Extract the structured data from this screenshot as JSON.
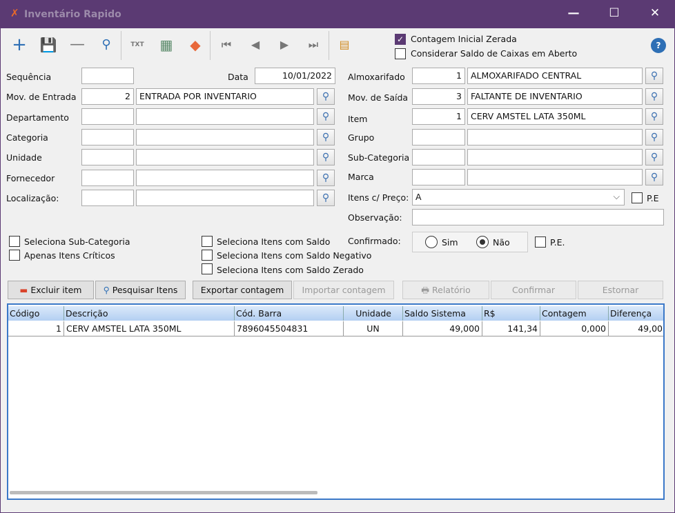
{
  "window": {
    "title": "Inventário Rapido",
    "minimize": "—",
    "maximize": "☐",
    "close": "✕"
  },
  "toolbar": {
    "icons": [
      "plus-icon",
      "save-icon",
      "minus-icon",
      "search-icon",
      "txt-export-icon",
      "grid-icon",
      "eraser-icon",
      "first-icon",
      "prev-icon",
      "next-icon",
      "last-icon",
      "log-icon"
    ],
    "contagem_inicial_zerada": {
      "label": "Contagem Inicial Zerada",
      "checked": true
    },
    "considerar_saldo": {
      "label": "Considerar Saldo de Caixas em Aberto",
      "checked": false
    },
    "help": "?"
  },
  "form": {
    "sequencia": {
      "label": "Sequência",
      "value": ""
    },
    "data": {
      "label": "Data",
      "value": "10/01/2022"
    },
    "mov_entrada": {
      "label": "Mov. de Entrada",
      "code": "2",
      "desc": "ENTRADA POR INVENTARIO"
    },
    "departamento": {
      "label": "Departamento",
      "code": "",
      "desc": ""
    },
    "categoria": {
      "label": "Categoria",
      "code": "",
      "desc": ""
    },
    "unidade": {
      "label": "Unidade",
      "code": "",
      "desc": ""
    },
    "fornecedor": {
      "label": "Fornecedor",
      "code": "",
      "desc": ""
    },
    "localizacao": {
      "label": "Localização:",
      "code": "",
      "desc": ""
    },
    "almoxarifado": {
      "label": "Almoxarifado",
      "code": "1",
      "desc": "ALMOXARIFADO CENTRAL"
    },
    "mov_saida": {
      "label": "Mov. de Saída",
      "code": "3",
      "desc": "FALTANTE DE INVENTARIO"
    },
    "item": {
      "label": "Item",
      "code": "1",
      "desc": "CERV AMSTEL LATA 350ML"
    },
    "grupo": {
      "label": "Grupo",
      "code": "",
      "desc": ""
    },
    "subcategoria": {
      "label": "Sub-Categoria",
      "code": "",
      "desc": ""
    },
    "marca": {
      "label": "Marca",
      "code": "",
      "desc": ""
    },
    "itens_preco": {
      "label": "Itens c/ Preço:",
      "value": "A",
      "pe_label": "P.E",
      "pe_checked": false
    },
    "observacao": {
      "label": "Observação:",
      "value": ""
    }
  },
  "options": {
    "seleciona_subcategoria": "Seleciona Sub-Categoria",
    "apenas_criticos": "Apenas Itens Críticos",
    "itens_saldo": "Seleciona Itens com Saldo",
    "itens_saldo_negativo": "Seleciona Itens com Saldo Negativo",
    "itens_saldo_zerado": "Seleciona Itens com Saldo Zerado",
    "confirmado": {
      "label": "Confirmado:",
      "sim": "Sim",
      "nao": "Não",
      "selected": "Não",
      "pe_label": "P.E."
    }
  },
  "buttons": {
    "excluir": "Excluir item",
    "pesquisar": "Pesquisar Itens",
    "exportar": "Exportar contagem",
    "importar": "Importar contagem",
    "relatorio": "Relatório",
    "confirmar": "Confirmar",
    "estornar": "Estornar"
  },
  "grid": {
    "columns": [
      "Código",
      "Descrição",
      "Cód. Barra",
      "Unidade",
      "Saldo Sistema",
      "R$",
      "Contagem",
      "Diferença"
    ],
    "rows": [
      [
        "1",
        "CERV AMSTEL LATA 350ML",
        "7896045504831",
        "UN",
        "49,000",
        "141,34",
        "0,000",
        "49,00"
      ]
    ]
  }
}
